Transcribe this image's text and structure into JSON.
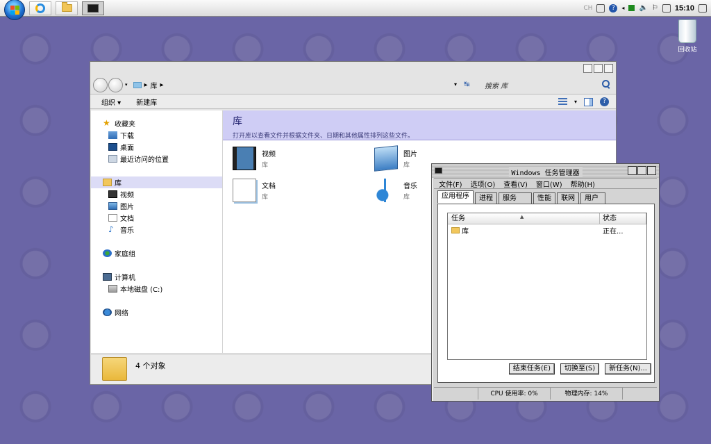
{
  "taskbar": {
    "tray_ime": "CH",
    "tray_help": "?",
    "clock": "15:10"
  },
  "desktop": {
    "recycle_bin_label": "回收站"
  },
  "explorer": {
    "breadcrumb": "库",
    "search_placeholder": "搜索 库",
    "toolbar": {
      "organize": "组织 ▾",
      "new_library": "新建库"
    },
    "nav": {
      "favorites": "收藏夹",
      "downloads": "下载",
      "desktop": "桌面",
      "recent": "最近访问的位置",
      "libraries": "库",
      "videos": "视频",
      "pictures": "图片",
      "documents": "文档",
      "music": "音乐",
      "homegroup": "家庭组",
      "computer": "计算机",
      "local_disk": "本地磁盘 (C:)",
      "network": "网络"
    },
    "header": {
      "title": "库",
      "description": "打开库以查看文件并根据文件夹、日期和其他属性排列这些文件。"
    },
    "items": [
      {
        "name": "视频",
        "sub": "库"
      },
      {
        "name": "图片",
        "sub": "库"
      },
      {
        "name": "文档",
        "sub": "库"
      },
      {
        "name": "音乐",
        "sub": "库"
      }
    ],
    "status": "4 个对象"
  },
  "taskmgr": {
    "title": "Windows 任务管理器",
    "menu": [
      "文件(F)",
      "选项(O)",
      "查看(V)",
      "窗口(W)",
      "帮助(H)"
    ],
    "tabs": [
      "应用程序",
      "进程",
      "服务",
      "性能",
      "联网",
      "用户"
    ],
    "columns": {
      "task": "任务",
      "status": "状态"
    },
    "rows": [
      {
        "task": "库",
        "status": "正在..."
      }
    ],
    "buttons": {
      "end_task": "结束任务(E)",
      "switch_to": "切换至(S)",
      "new_task": "新任务(N)..."
    },
    "status": {
      "cpu": "CPU 使用率: 0%",
      "memory": "物理内存: 14%"
    }
  }
}
